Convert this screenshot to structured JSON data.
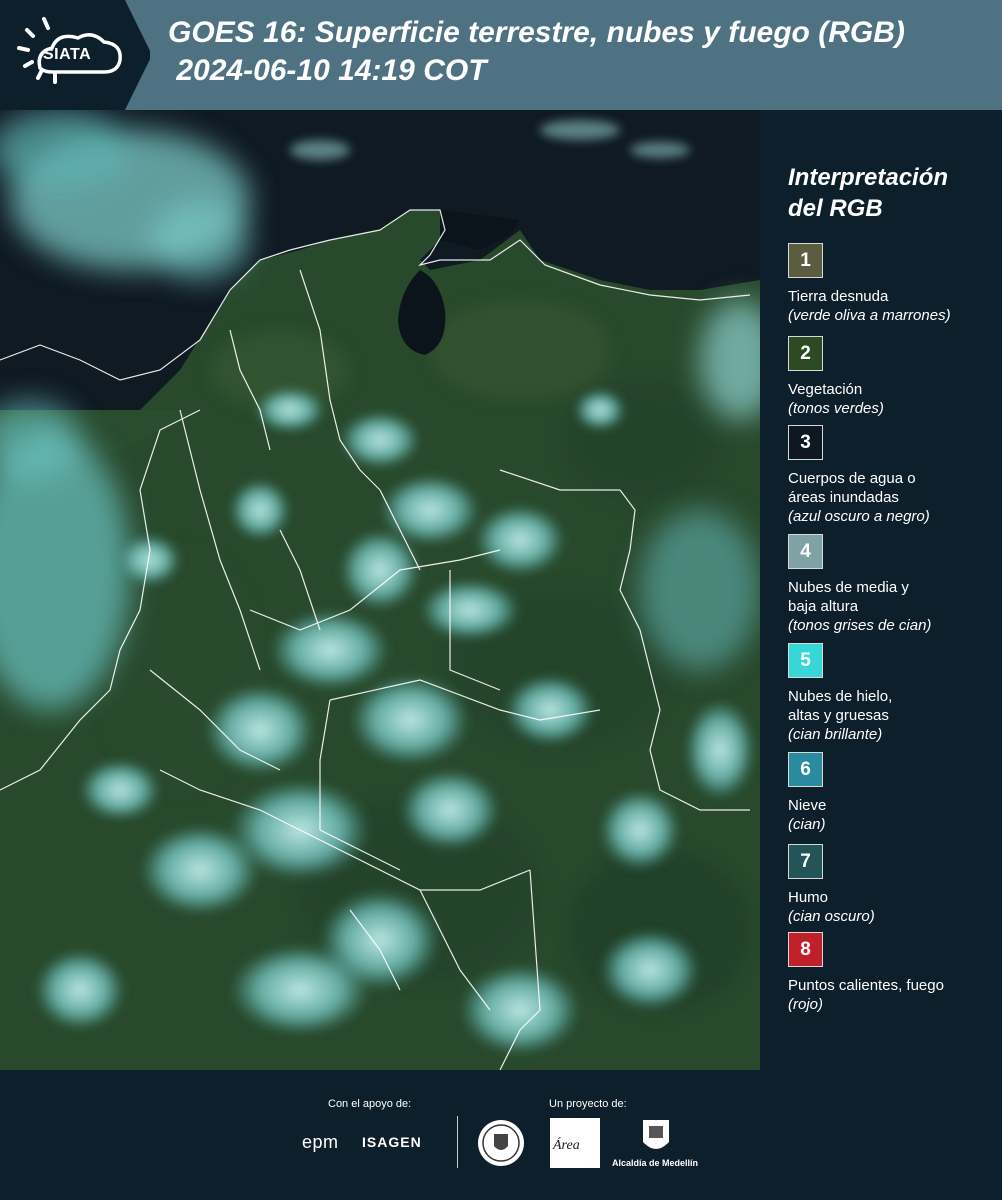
{
  "header": {
    "logo_text": "SIATA",
    "title_line1": "GOES 16: Superficie terrestre, nubes y fuego (RGB)",
    "title_line2": " 2024-06-10 14:19 COT"
  },
  "legend": {
    "title_line1": "Interpretación",
    "title_line2": "del RGB",
    "items": [
      {
        "num": "1",
        "color": "#5c5c40",
        "label": "Tierra desnuda",
        "sub": "(verde oliva a marrones)"
      },
      {
        "num": "2",
        "color": "#2e4a25",
        "label": "Vegetación",
        "sub": "(tonos verdes)"
      },
      {
        "num": "3",
        "color": "#0e1820",
        "label": "Cuerpos de agua o áreas inundadas",
        "sub": "(azul oscuro a negro)"
      },
      {
        "num": "4",
        "color": "#7fa3a5",
        "label": "Nubes de media y baja altura",
        "sub": "(tonos grises de cian)"
      },
      {
        "num": "5",
        "color": "#37d7d7",
        "label": "Nubes de hielo, altas y gruesas",
        "sub": "(cian brillante)"
      },
      {
        "num": "6",
        "color": "#2a8a9e",
        "label": "Nieve",
        "sub": "(cian)"
      },
      {
        "num": "7",
        "color": "#235558",
        "label": "Humo",
        "sub": "(cian oscuro)"
      },
      {
        "num": "8",
        "color": "#c0202a",
        "label": "Puntos calientes, fuego",
        "sub": "(rojo)"
      }
    ]
  },
  "footer": {
    "support_label": "Con el apoyo de:",
    "project_label": "Un proyecto de:",
    "epm": "epm",
    "isagen": "ISAGEN",
    "area_text": "Área",
    "medellin": "Alcaldía de Medellín"
  }
}
